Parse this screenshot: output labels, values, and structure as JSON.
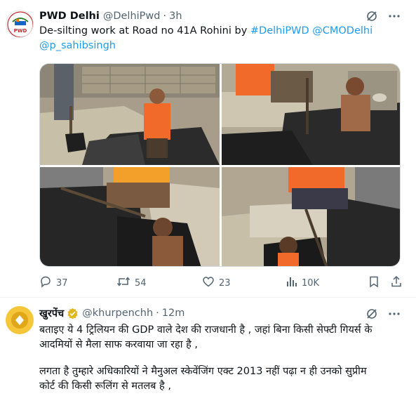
{
  "tweet1": {
    "author_name": "PWD Delhi",
    "author_handle": "@DelhiPwd",
    "time": "3h",
    "avatar_label": "PWD",
    "text_plain": "De-silting work at Road no 41A Rohini by ",
    "mention_1": "#DelhiPWD",
    "mention_2": "@CMODelhi",
    "mention_3": "@p_sahibsingh",
    "stats": {
      "replies": "37",
      "reposts": "54",
      "likes": "23",
      "views": "10K"
    }
  },
  "tweet2": {
    "author_name": "खुरपेंच",
    "author_handle": "@khurpenchh",
    "time": "12m",
    "line1": "बताइए ये 4 ट्रिलियन की GDP वाले देश की राजधानी है , जहां बिना किसी सेफ्टी गियर्स के",
    "line2": "आदमियों से मैला साफ करवाया जा रहा है ,",
    "line3": "लगता है तुम्हारे अधिकारियों ने मैनुअल स्केवेंजिंग एक्ट 2013 नहीं पढ़ा न ही उनको सुप्रीम",
    "line4": "कोर्ट की किसी रूलिंग से मतलब है ,"
  },
  "colors": {
    "link": "#1d9bf0",
    "secondary_text": "#536471",
    "verified_gold": "#e2b719"
  }
}
